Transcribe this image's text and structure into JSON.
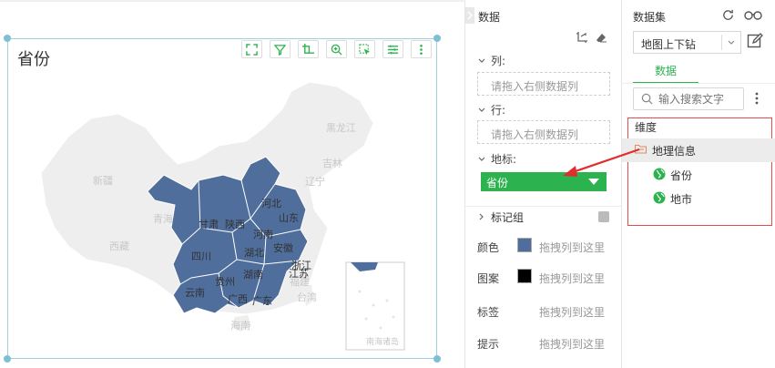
{
  "chart": {
    "title": "省份",
    "toolbar": [
      "fullscreen-icon",
      "filter-icon",
      "crop-icon",
      "zoom-in-icon",
      "select-icon",
      "list-icon",
      "more-icon"
    ],
    "highlight_color": "#4f6e9c",
    "base_color": "#eeeeee",
    "province_labels": {
      "xinjiang": "新疆",
      "xizang": "西藏",
      "qinghai": "青海",
      "gansu": "甘肃",
      "shaanxi": "陕西",
      "sichuan": "四川",
      "henan": "河南",
      "hubei": "湖北",
      "anhui": "安徽",
      "jiangsu": "江苏",
      "zhejiang": "浙江",
      "hunan": "湖南",
      "guizhou": "贵州",
      "yunnan": "云南",
      "guangxi": "广西",
      "guangdong": "广东",
      "hainan": "海南",
      "taiwan": "台湾",
      "hebei": "河北",
      "shanxi": "山东",
      "liaoning": "辽宁",
      "jilin": "吉林",
      "heilongjiang": "黑龙江",
      "fujian": "福建"
    },
    "inset_label": "南海诸岛"
  },
  "fields": {
    "title": "数据",
    "columns_label": "列:",
    "columns_placeholder": "请拖入右侧数据列",
    "rows_label": "行:",
    "rows_placeholder": "请拖入右侧数据列",
    "geo_label": "地标:",
    "geo_value": "省份",
    "mark_group_label": "标记组",
    "props": [
      {
        "name": "颜色",
        "hint": "拖拽列到这里",
        "swatch": "#4f6e9c"
      },
      {
        "name": "图案",
        "hint": "拖拽列到这里",
        "swatch": "#000000"
      },
      {
        "name": "标签",
        "hint": "拖拽列到这里"
      },
      {
        "name": "提示",
        "hint": "拖拽列到这里"
      }
    ]
  },
  "dataset": {
    "title": "数据集",
    "selected": "地图上下钻",
    "tab": "数据",
    "search_placeholder": "输入搜索文字",
    "dimension_label": "维度",
    "folder_label": "地理信息",
    "leaves": [
      "省份",
      "地市"
    ],
    "accent": "#2cb34f"
  }
}
